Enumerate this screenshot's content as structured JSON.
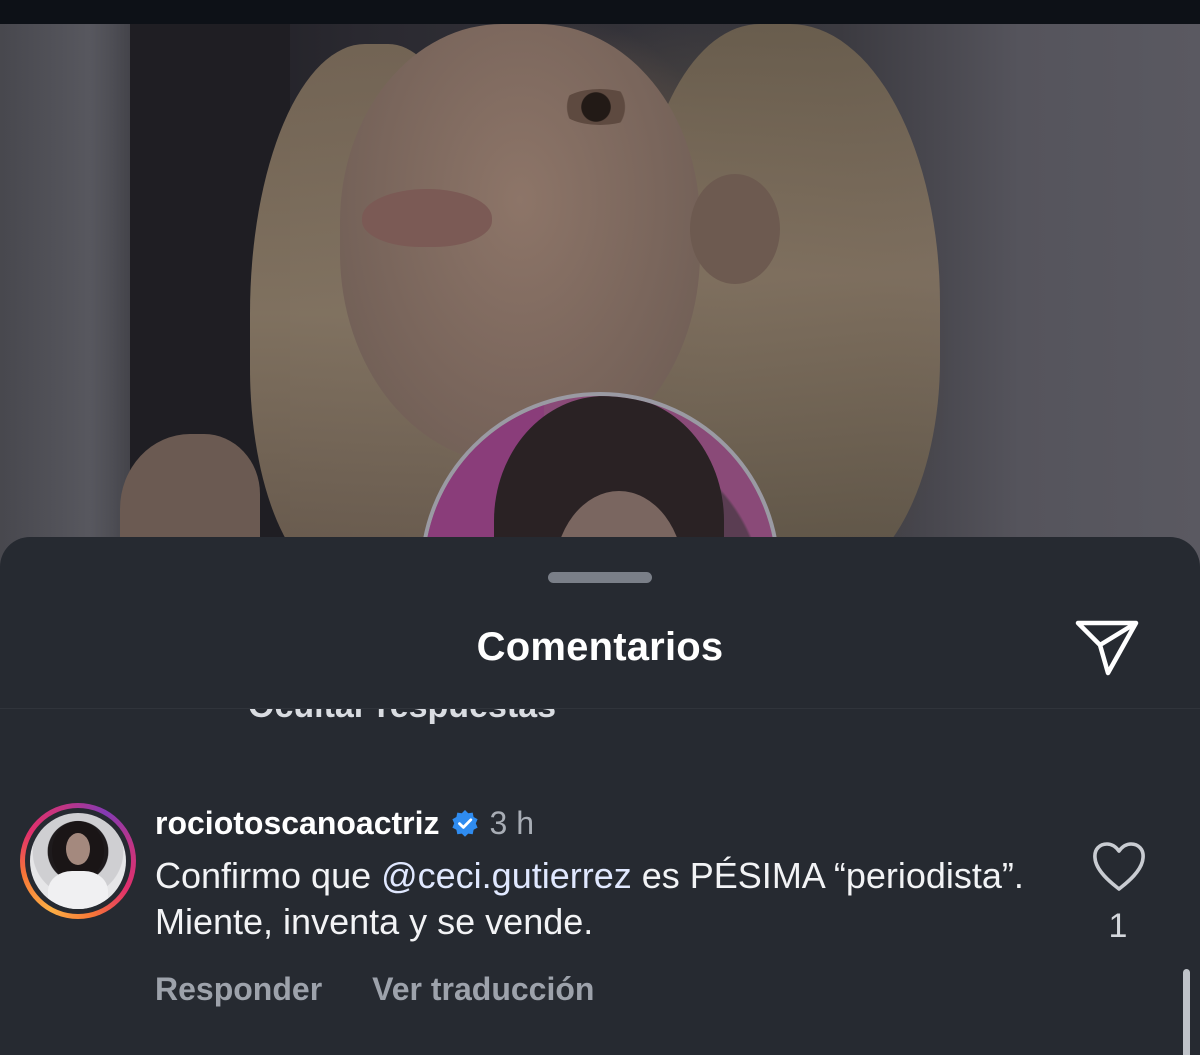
{
  "sheet": {
    "title": "Comentarios",
    "partial_text": "Ocultar respuestas"
  },
  "comment": {
    "username": "rociotoscanoactriz",
    "verified": true,
    "timestamp": "3 h",
    "text_before": "Confirmo que ",
    "mention": "@ceci.gutierrez",
    "text_after": "  es PÉSIMA “periodista”. Miente, inventa y se vende.",
    "likes": "1",
    "reply_label": "Responder",
    "translate_label": "Ver traducción"
  },
  "icons": {
    "share": "paper-plane-icon",
    "like": "heart-outline-icon",
    "verified": "verified-badge-icon"
  },
  "colors": {
    "sheet_bg": "#262a31",
    "verified_blue": "#2f8cf0",
    "story_ring": [
      "#fcaf45",
      "#f77737",
      "#e1306c",
      "#c13584",
      "#833ab4"
    ]
  }
}
